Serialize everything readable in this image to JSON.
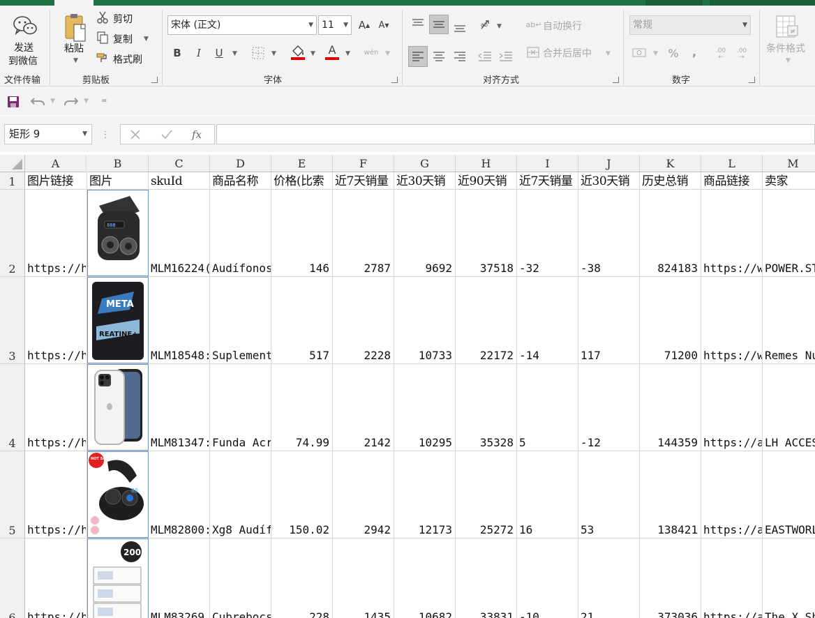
{
  "ribbon": {
    "send_wechat": {
      "line1": "发送",
      "line2": "到微信",
      "group": "文件传输"
    },
    "clipboard": {
      "paste": "粘贴",
      "cut": "剪切",
      "copy": "复制",
      "format_painter": "格式刷",
      "group": "剪贴板"
    },
    "font": {
      "name": "宋体 (正文)",
      "size": "11",
      "bold": "B",
      "italic": "I",
      "underline": "U",
      "font_color_glyph": "A",
      "wen_glyph": "wén",
      "group": "字体",
      "font_color": "#e00000",
      "fill_color": "#e00000"
    },
    "alignment": {
      "wrap_text": "自动换行",
      "merge_center": "合并后居中",
      "group": "对齐方式"
    },
    "number": {
      "format": "常规",
      "percent": "%",
      "comma": ",",
      "inc_decimal": ".00",
      "dec_decimal": ".00",
      "group": "数字"
    },
    "styles": {
      "conditional_format": "条件格式"
    }
  },
  "formula_bar": {
    "name_box": "矩形 9",
    "fx_label": "fx",
    "formula": ""
  },
  "grid": {
    "columns": [
      "A",
      "B",
      "C",
      "D",
      "E",
      "F",
      "G",
      "H",
      "I",
      "J",
      "K",
      "L",
      "M"
    ],
    "rows": [
      "1",
      "2",
      "3",
      "4",
      "5",
      "6"
    ],
    "header_row": [
      "图片链接",
      "图片",
      "skuId",
      "商品名称",
      "价格(比索",
      "近7天销量",
      "近30天销",
      "近90天销",
      "近7天销量",
      "近30天销",
      "历史总销",
      "商品链接",
      "卖家"
    ],
    "data_rows": [
      [
        "https://h",
        "",
        "MLM16224(",
        "Audífonos",
        "146",
        "2787",
        "9692",
        "37518",
        "-32",
        "-38",
        "824183",
        "https://w",
        "POWER.ST"
      ],
      [
        "https://h",
        "",
        "MLM18548:",
        "Suplement",
        "517",
        "2228",
        "10733",
        "22172",
        "-14",
        "117",
        "71200",
        "https://w",
        "Remes Nu"
      ],
      [
        "https://h",
        "",
        "MLM81347:",
        "Funda Acr",
        "74.99",
        "2142",
        "10295",
        "35328",
        "5",
        "-12",
        "144359",
        "https://a",
        "LH ACCES"
      ],
      [
        "https://h",
        "",
        "MLM82800:",
        "Xg8 Audíf",
        "150.02",
        "2942",
        "12173",
        "25272",
        "16",
        "53",
        "138421",
        "https://a",
        "EASTWORL"
      ],
      [
        "https://h",
        "",
        "MLM83269",
        "Cubrebocs",
        "228",
        "1435",
        "10682",
        "33831",
        "-10",
        "21",
        "373036",
        "https://a",
        "The X Sh"
      ]
    ],
    "images": [
      "earbuds-case",
      "creatine-bag",
      "phone-case",
      "earbuds-hot-sale",
      "mask-boxes-200"
    ],
    "image_labels": {
      "creatine": "META",
      "creatine_sub": "REATINE+",
      "hot_sale": "HOT SALE",
      "box_count": "200"
    }
  }
}
